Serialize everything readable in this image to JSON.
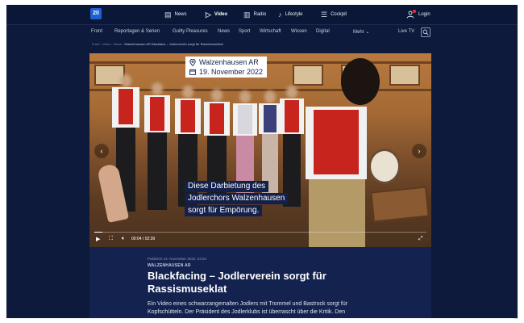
{
  "header": {
    "logo": "20",
    "nav": [
      {
        "label": "News",
        "icon": "newspaper-icon",
        "glyph": "▤",
        "active": false
      },
      {
        "label": "Video",
        "icon": "play-icon",
        "glyph": "▷",
        "active": true
      },
      {
        "label": "Radio",
        "icon": "radio-icon",
        "glyph": "▥",
        "active": false
      },
      {
        "label": "Lifestyle",
        "icon": "lipstick-icon",
        "glyph": "♪",
        "active": false
      },
      {
        "label": "Cockpit",
        "icon": "sliders-icon",
        "glyph": "☰",
        "active": false
      }
    ],
    "login_label": "Login"
  },
  "subnav": {
    "items": [
      "Front",
      "Reportagen & Serien",
      "Guilty Pleasures",
      "News",
      "Sport",
      "Wirtschaft",
      "Wissen",
      "Digital"
    ],
    "more_label": "Mehr",
    "live_label": "Live TV"
  },
  "breadcrumb": {
    "items": [
      "Front",
      "Video",
      "News"
    ],
    "current": "Walzenhausen AR Blackface – Jodlerverein sorgt für Rassismuseklat"
  },
  "video": {
    "location": "Walzenhausen AR",
    "date": "19. November 2022",
    "caption_lines": [
      "Diese Darbietung des",
      "Jodlerchors Walzenhausen",
      "sorgt für Empörung."
    ],
    "time_current": "00:04",
    "time_separator": "/",
    "time_total": "02:39",
    "progress": 0.025
  },
  "article": {
    "published": "Publiziert 22. November 2022, 04:54",
    "kicker": "WALZENHAUSEN AR",
    "headline": "Blackfacing – Jodlerverein sorgt für Rassismuseklat",
    "lead": "Ein Video eines schwarzangemalten Jodlers mit Trommel und Bastrock sorgt für Kopfschütteln. Der Präsident des Jodlerklubs ist überrascht über die Kritik. Den"
  }
}
